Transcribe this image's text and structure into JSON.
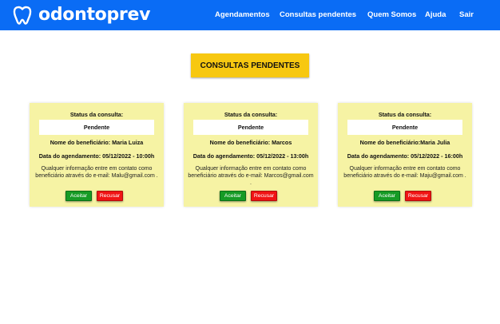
{
  "colors": {
    "nav_bg": "#0a6cf5",
    "page_button": "#f7c811",
    "card_bg": "#f6f3a4",
    "accept": "#169b25",
    "refuse": "#f01414"
  },
  "header": {
    "brand": "odontoprev",
    "logo_icon": "tooth-icon",
    "nav": [
      "Agendamentos",
      "Consultas pendentes",
      "Quem Somos",
      "Ajuda",
      "Sair"
    ]
  },
  "main": {
    "page_button_label": "CONSULTAS PENDENTES",
    "cards": [
      {
        "status_label": "Status da consulta:",
        "status_value": "Pendente",
        "beneficiary": "Nome do beneficiário: Maria Luiza",
        "date": "Data do agendamento: 05/12/2022 - 10:00h",
        "info": "Qualquer informação entre em contato como beneficiário através do e-mail: Malu@gmail.com .",
        "accept_label": "Aceitar",
        "refuse_label": "Recusar"
      },
      {
        "status_label": "Status da consulta:",
        "status_value": "Pendente",
        "beneficiary": "Nome do beneficiário: Marcos",
        "date": "Data do agendamento: 05/12/2022 - 13:00h",
        "info": "Qualquer informação entre em contato como beneficiário através do e-mail: Marcos@gmail.com .",
        "accept_label": "Aceitar",
        "refuse_label": "Recusar"
      },
      {
        "status_label": "Status da consulta:",
        "status_value": "Pendente",
        "beneficiary": "Nome do beneficiário:Maria Julia",
        "date": "Data do agendamento: 05/12/2022 - 16:00h",
        "info": "Qualquer informação entre em contato como beneficiário através do e-mail: Maju@gmail.com .",
        "accept_label": "Aceitar",
        "refuse_label": "Recusar"
      }
    ]
  }
}
